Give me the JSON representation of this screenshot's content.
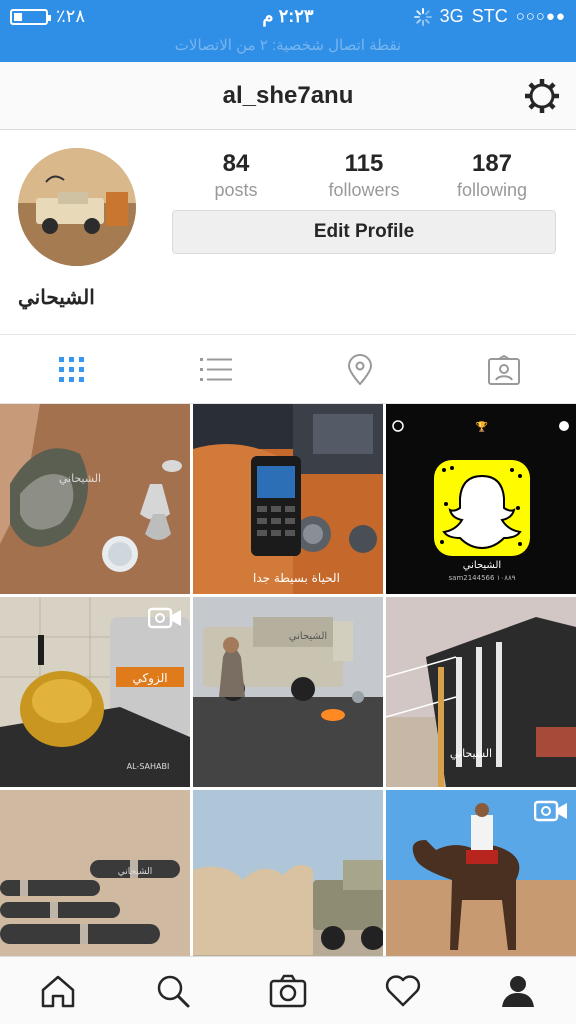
{
  "status_bar": {
    "battery_text": "٪٢٨",
    "battery_level": 0.28,
    "time": "٢:٢٣ م",
    "network": "3G",
    "carrier": "STC",
    "signal_dots": "○○○●●",
    "notice": "نقطة اتصال شخصية: ٢ من الاتصالات"
  },
  "header": {
    "username": "al_she7anu",
    "settings_icon": "gear-icon"
  },
  "profile": {
    "posts_count": "84",
    "posts_label": "posts",
    "followers_count": "115",
    "followers_label": "followers",
    "following_count": "187",
    "following_label": "following",
    "edit_button": "Edit Profile",
    "display_name": "الشيحاني"
  },
  "tabs": [
    {
      "icon": "grid-icon",
      "active": true
    },
    {
      "icon": "list-icon",
      "active": false
    },
    {
      "icon": "location-pin-icon",
      "active": false
    },
    {
      "icon": "tagged-photos-icon",
      "active": false
    }
  ],
  "grid": {
    "tile_1_caption": "الشيحاني",
    "tile_2_caption": "الحياة بسيطة جدا",
    "tile_3_caption": "الشيحاني",
    "tile_3_code": "sam2144566 ١٠٨٨٩",
    "tile_4_brand": "الزوكي",
    "tile_4_caption": "AL-SAHABI",
    "tile_5_caption": "الشيحاني",
    "tile_6_caption": "الشيحاني",
    "tile_7_caption": "الشيحاني"
  },
  "bottom_nav": [
    {
      "icon": "home-icon"
    },
    {
      "icon": "search-icon"
    },
    {
      "icon": "camera-icon"
    },
    {
      "icon": "heart-icon"
    },
    {
      "icon": "profile-icon",
      "active": true
    }
  ],
  "colors": {
    "status_bar": "#2f8ee6",
    "active_tab": "#3897f0",
    "text": "#262626",
    "muted": "#999999"
  }
}
